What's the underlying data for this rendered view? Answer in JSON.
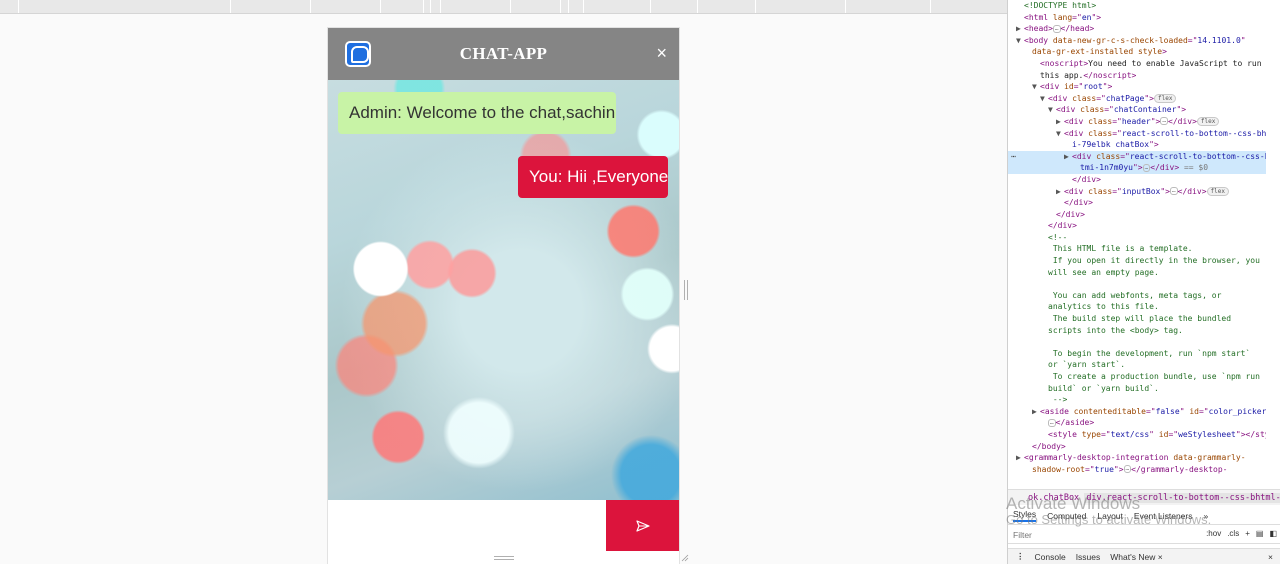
{
  "chat": {
    "title": "CHAT-APP",
    "close_label": "×",
    "messages": [
      {
        "sender": "Admin",
        "text": "Admin: Welcome to the chat,sachin",
        "side": "left",
        "color": "#c8f3a6"
      },
      {
        "sender": "You",
        "text": "You: Hii ,Everyone",
        "side": "right",
        "color": "#dc143c"
      }
    ],
    "input_value": "",
    "header_color": "#858585",
    "accent_color": "#dc143c",
    "logo_icon": "chat-bubble-icon",
    "send_icon": "send-arrow-icon"
  },
  "devtools": {
    "tree_lines": [
      {
        "parts": [
          [
            "c",
            "<!DOCTYPE html>"
          ]
        ],
        "indent": 1,
        "tri": ""
      },
      {
        "parts": [
          [
            "t",
            "<html "
          ],
          [
            "a",
            "lang"
          ],
          [
            "t",
            "=\""
          ],
          [
            "v",
            "en"
          ],
          [
            "t",
            "\">"
          ]
        ],
        "indent": 1,
        "tri": ""
      },
      {
        "parts": [
          [
            "t",
            "<head>"
          ],
          [
            "ell",
            "…"
          ],
          [
            "t",
            "</head>"
          ]
        ],
        "indent": 1,
        "tri": "▶"
      },
      {
        "parts": [
          [
            "t",
            "<body "
          ],
          [
            "a",
            "data-new-gr-c-s-check-loaded"
          ],
          [
            "t",
            "=\""
          ],
          [
            "v",
            "14.1101.0"
          ],
          [
            "t",
            "\""
          ]
        ],
        "indent": 1,
        "tri": "▼"
      },
      {
        "parts": [
          [
            "a",
            "data-gr-ext-installed"
          ],
          [
            "t",
            " "
          ],
          [
            "a",
            "style"
          ],
          [
            "t",
            ">"
          ]
        ],
        "indent": 2,
        "tri": ""
      },
      {
        "parts": [
          [
            "t",
            "<noscript>"
          ],
          [
            "p",
            "You need to enable JavaScript to run"
          ]
        ],
        "indent": 3,
        "tri": ""
      },
      {
        "parts": [
          [
            "p",
            "this app."
          ],
          [
            "t",
            "</noscript>"
          ]
        ],
        "indent": 3,
        "tri": ""
      },
      {
        "parts": [
          [
            "t",
            "<div "
          ],
          [
            "a",
            "id"
          ],
          [
            "t",
            "=\""
          ],
          [
            "v",
            "root"
          ],
          [
            "t",
            "\">"
          ]
        ],
        "indent": 3,
        "tri": "▼"
      },
      {
        "parts": [
          [
            "t",
            "<div "
          ],
          [
            "a",
            "class"
          ],
          [
            "t",
            "=\""
          ],
          [
            "v",
            "chatPage"
          ],
          [
            "t",
            "\">"
          ],
          [
            "badge",
            "flex"
          ]
        ],
        "indent": 4,
        "tri": "▼"
      },
      {
        "parts": [
          [
            "t",
            "<div "
          ],
          [
            "a",
            "class"
          ],
          [
            "t",
            "=\""
          ],
          [
            "v",
            "chatContainer"
          ],
          [
            "t",
            "\">"
          ]
        ],
        "indent": 5,
        "tri": "▼"
      },
      {
        "parts": [
          [
            "t",
            "<div "
          ],
          [
            "a",
            "class"
          ],
          [
            "t",
            "=\""
          ],
          [
            "v",
            "header"
          ],
          [
            "t",
            "\">"
          ],
          [
            "ell",
            "…"
          ],
          [
            "t",
            "</div>"
          ],
          [
            "badge",
            "flex"
          ]
        ],
        "indent": 6,
        "tri": "▶"
      },
      {
        "parts": [
          [
            "t",
            "<div "
          ],
          [
            "a",
            "class"
          ],
          [
            "t",
            "=\""
          ],
          [
            "v",
            "react-scroll-to-bottom--css-bhtm"
          ]
        ],
        "indent": 6,
        "tri": "▼"
      },
      {
        "parts": [
          [
            "v",
            "i-79elbk chatBox"
          ],
          [
            "t",
            "\">"
          ]
        ],
        "indent": 7,
        "tri": ""
      },
      {
        "parts": [
          [
            "t",
            "<div "
          ],
          [
            "a",
            "class"
          ],
          [
            "t",
            "=\""
          ],
          [
            "v",
            "react-scroll-to-bottom--css-bh"
          ]
        ],
        "indent": 7,
        "tri": "▶",
        "selected": true
      },
      {
        "parts": [
          [
            "v",
            "tmi-1n7m0yu"
          ],
          [
            "t",
            "\">"
          ],
          [
            "ell",
            "…"
          ],
          [
            "t",
            "</div>"
          ],
          [
            "dim",
            " == $0"
          ]
        ],
        "indent": 8,
        "tri": "",
        "selected": true
      },
      {
        "parts": [
          [
            "t",
            "</div>"
          ]
        ],
        "indent": 7,
        "tri": ""
      },
      {
        "parts": [
          [
            "t",
            "<div "
          ],
          [
            "a",
            "class"
          ],
          [
            "t",
            "=\""
          ],
          [
            "v",
            "inputBox"
          ],
          [
            "t",
            "\">"
          ],
          [
            "ell",
            "…"
          ],
          [
            "t",
            "</div>"
          ],
          [
            "badge",
            "flex"
          ]
        ],
        "indent": 6,
        "tri": "▶"
      },
      {
        "parts": [
          [
            "t",
            "</div>"
          ]
        ],
        "indent": 6,
        "tri": ""
      },
      {
        "parts": [
          [
            "t",
            "</div>"
          ]
        ],
        "indent": 5,
        "tri": ""
      },
      {
        "parts": [
          [
            "t",
            "</div>"
          ]
        ],
        "indent": 4,
        "tri": ""
      },
      {
        "parts": [
          [
            "c",
            "<!--"
          ]
        ],
        "indent": 4,
        "tri": ""
      },
      {
        "parts": [
          [
            "c",
            "    This HTML file is a template."
          ]
        ],
        "indent": 4,
        "tri": ""
      },
      {
        "parts": [
          [
            "c",
            "    If you open it directly in the browser, you"
          ]
        ],
        "indent": 4,
        "tri": ""
      },
      {
        "parts": [
          [
            "c",
            "will see an empty page."
          ]
        ],
        "indent": 4,
        "tri": ""
      },
      {
        "parts": [
          [
            "c",
            ""
          ]
        ],
        "indent": 4,
        "tri": ""
      },
      {
        "parts": [
          [
            "c",
            "    You can add webfonts, meta tags, or"
          ]
        ],
        "indent": 4,
        "tri": ""
      },
      {
        "parts": [
          [
            "c",
            "analytics to this file."
          ]
        ],
        "indent": 4,
        "tri": ""
      },
      {
        "parts": [
          [
            "c",
            "    The build step will place the bundled"
          ]
        ],
        "indent": 4,
        "tri": ""
      },
      {
        "parts": [
          [
            "c",
            "scripts into the <body> tag."
          ]
        ],
        "indent": 4,
        "tri": ""
      },
      {
        "parts": [
          [
            "c",
            ""
          ]
        ],
        "indent": 4,
        "tri": ""
      },
      {
        "parts": [
          [
            "c",
            "    To begin the development, run `npm start`"
          ]
        ],
        "indent": 4,
        "tri": ""
      },
      {
        "parts": [
          [
            "c",
            "or `yarn start`."
          ]
        ],
        "indent": 4,
        "tri": ""
      },
      {
        "parts": [
          [
            "c",
            "    To create a production bundle, use `npm run"
          ]
        ],
        "indent": 4,
        "tri": ""
      },
      {
        "parts": [
          [
            "c",
            "build` or `yarn build`."
          ]
        ],
        "indent": 4,
        "tri": ""
      },
      {
        "parts": [
          [
            "c",
            "    -->"
          ]
        ],
        "indent": 4,
        "tri": ""
      },
      {
        "parts": [
          [
            "t",
            "<aside "
          ],
          [
            "a",
            "contenteditable"
          ],
          [
            "t",
            "=\""
          ],
          [
            "v",
            "false"
          ],
          [
            "t",
            "\" "
          ],
          [
            "a",
            "id"
          ],
          [
            "t",
            "=\""
          ],
          [
            "v",
            "color_picker"
          ],
          [
            "t",
            "\">"
          ]
        ],
        "indent": 3,
        "tri": "▶"
      },
      {
        "parts": [
          [
            "ell",
            "…"
          ],
          [
            "t",
            "</aside>"
          ]
        ],
        "indent": 4,
        "tri": ""
      },
      {
        "parts": [
          [
            "t",
            "<style "
          ],
          [
            "a",
            "type"
          ],
          [
            "t",
            "=\""
          ],
          [
            "v",
            "text/css"
          ],
          [
            "t",
            "\" "
          ],
          [
            "a",
            "id"
          ],
          [
            "t",
            "=\""
          ],
          [
            "v",
            "weStylesheet"
          ],
          [
            "t",
            "\"></style>"
          ]
        ],
        "indent": 4,
        "tri": ""
      },
      {
        "parts": [
          [
            "t",
            "</body>"
          ]
        ],
        "indent": 2,
        "tri": ""
      },
      {
        "parts": [
          [
            "t",
            "<grammarly-desktop-integration "
          ],
          [
            "a",
            "data-grammarly-"
          ]
        ],
        "indent": 1,
        "tri": "▶"
      },
      {
        "parts": [
          [
            "a",
            "shadow-root"
          ],
          [
            "t",
            "=\""
          ],
          [
            "v",
            "true"
          ],
          [
            "t",
            "\">"
          ],
          [
            "ell",
            "…"
          ],
          [
            "t",
            "</grammarly-desktop-"
          ]
        ],
        "indent": 2,
        "tri": ""
      }
    ],
    "breadcrumb": [
      "ok.chatBox",
      "div.react-scroll-to-bottom--css-bhtml-1n7m0yu"
    ],
    "tabs": [
      "Styles",
      "Computed",
      "Layout",
      "Event Listeners",
      "»"
    ],
    "active_tab": "Styles",
    "filter_placeholder": "Filter",
    "filter_tools": [
      ":hov",
      ".cls",
      "+"
    ],
    "drawer_tabs": [
      "Console",
      "Issues",
      "What's New ×"
    ],
    "watermark_line1": "Activate Windows",
    "watermark_line2": "Go to Settings to activate Windows."
  }
}
